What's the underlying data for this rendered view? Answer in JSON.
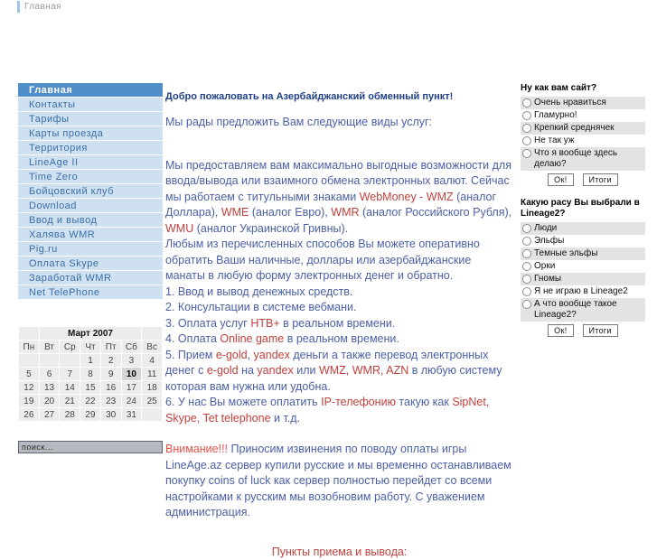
{
  "topbar": {
    "tab_label": "Главная"
  },
  "sidebar": {
    "menu": [
      {
        "label": "Главная",
        "active": true
      },
      {
        "label": "Контакты",
        "active": false
      },
      {
        "label": "Тарифы",
        "active": false
      },
      {
        "label": "Карты проезда",
        "active": false
      },
      {
        "label": "Территория",
        "active": false
      },
      {
        "label": "LineAge II",
        "active": false
      },
      {
        "label": "Time Zero",
        "active": false
      },
      {
        "label": "Бойцовский клуб",
        "active": false
      },
      {
        "label": "Download",
        "active": false
      },
      {
        "label": "Ввод и вывод",
        "active": false
      },
      {
        "label": "Халява WMR",
        "active": false
      },
      {
        "label": "Pig.ru",
        "active": false
      },
      {
        "label": "Оплата Skype",
        "active": false
      },
      {
        "label": "Заработай WMR",
        "active": false
      },
      {
        "label": "Net TelePhone",
        "active": false
      }
    ],
    "calendar": {
      "title": "Март 2007",
      "dow": [
        "Пн",
        "Вт",
        "Ср",
        "Чт",
        "Пт",
        "Сб",
        "Вс"
      ],
      "weeks": [
        [
          "",
          "",
          "",
          "1",
          "2",
          "3",
          "4"
        ],
        [
          "5",
          "6",
          "7",
          "8",
          "9",
          "10",
          "11"
        ],
        [
          "12",
          "13",
          "14",
          "15",
          "16",
          "17",
          "18"
        ],
        [
          "19",
          "20",
          "21",
          "22",
          "23",
          "24",
          "25"
        ],
        [
          "26",
          "27",
          "28",
          "29",
          "30",
          "31",
          ""
        ]
      ],
      "today": "10"
    },
    "search": {
      "value": "поиск...",
      "placeholder": "поиск..."
    }
  },
  "main": {
    "heading": "Добро пожаловать на Азербайджанский обменный пункт!",
    "lead": "Мы рады предложить Вам следующие виды услуг:",
    "intro_1": "Мы предоставляем вам максимально выгодные возможности для ввода/вывода или взаимного обмена электронных валют. Сейчас мы работаем с титульными знаками ",
    "wm_webmoney": "WebMoney - WMZ",
    "intro_2": " (аналог Доллара), ",
    "wm_wme": "WME",
    "intro_3": " (аналог Евро), ",
    "wm_wmr": "WMR",
    "intro_4": " (аналог Российского Рубля), ",
    "wm_wmu": "WMU",
    "intro_5": " (аналог Украинской Гривны).",
    "intro_6": "Любым из перечисленных способов Вы можете оперативно обратить Ваши наличные, доллары или азербайджанские манаты в любую форму электронных денег и обратно.",
    "item1": "1. Ввод и вывод денежных средств.",
    "item2": "2. Консультации в системе вебмани.",
    "item3_a": "3. Оплата услуг ",
    "item3_red": "НТВ+",
    "item3_b": " в реальном времени.",
    "item4_a": "4. Оплата ",
    "item4_red": "Online game",
    "item4_b": " в реальном времени.",
    "item5_a": "5. Прием ",
    "item5_red1": "e-gold",
    "item5_b": ", ",
    "item5_red2": "yandex",
    "item5_c": " деньги а также перевод электронных денег с ",
    "item5_red3": "e-gold",
    "item5_d": " на ",
    "item5_red4": "yandex",
    "item5_e": " или ",
    "item5_red5": "WMZ, WMR, AZN",
    "item5_f": "  в любую систему которая вам нужна или удобна.",
    "item6_a": "6. У нас Вы можете оплатить ",
    "item6_red1": "IP-телефонию",
    "item6_b": "  такую как ",
    "item6_red2": "SipNet, Skype, Tet telephone",
    "item6_c": " и т.д.",
    "warn_label": "Внимание!!!",
    "warn_text": " Приносим извинения по поводу оплаты игры LineAge.az сервер купили русские и мы временно останавливаем покупку coins of luck как сервер полностью перейдет со всеми настройками к русским мы возобновим работу. С уважением администрация.",
    "footer_note": "Пункты приема и вывода:"
  },
  "polls": [
    {
      "question": "Ну как вам сайт?",
      "options": [
        "Очень нравиться",
        "Гламурно!",
        "Крепкий среднячек",
        "Не так уж",
        "Что я вообще здесь делаю?"
      ],
      "ok_label": "Ок!",
      "results_label": "Итоги"
    },
    {
      "question": "Какую расу Вы выбрали в Lineage2?",
      "options": [
        "Люди",
        "Эльфы",
        "Темные эльфы",
        "Орки",
        "Гномы",
        "Я не играю в Lineage2",
        "А что вообще такое Lineage2?"
      ],
      "ok_label": "Ок!",
      "results_label": "Итоги"
    }
  ],
  "colors": {
    "menu_bg": "#cfe0f1",
    "menu_active_bg": "#4f8ec9",
    "menu_text": "#3a6ea5",
    "body_text": "#4a5fa5",
    "accent_red": "#c1403c",
    "heading": "#1f3f87"
  }
}
